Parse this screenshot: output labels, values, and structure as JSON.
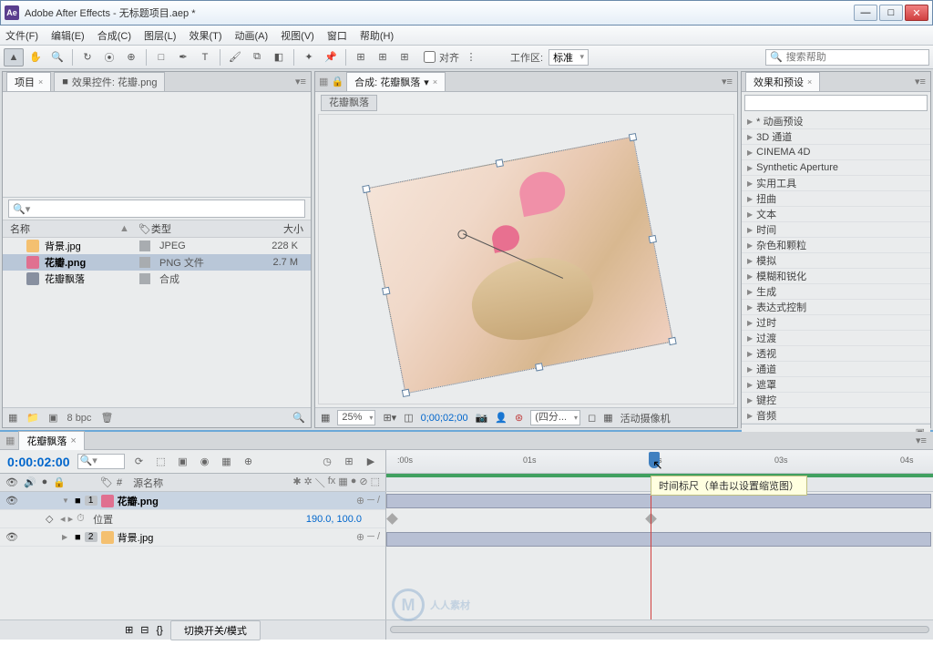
{
  "app": {
    "icon": "Ae",
    "title": "Adobe After Effects - 无标题项目.aep *"
  },
  "menu": [
    "文件(F)",
    "编辑(E)",
    "合成(C)",
    "图层(L)",
    "效果(T)",
    "动画(A)",
    "视图(V)",
    "窗口",
    "帮助(H)"
  ],
  "toolbar": {
    "align_label": "对齐",
    "workspace_label": "工作区:",
    "workspace_value": "标准",
    "search_placeholder": "搜索帮助"
  },
  "project": {
    "tab1": "项目",
    "tab2": "效果控件: 花瓣.png",
    "cols": {
      "name": "名称",
      "type": "类型",
      "size": "大小"
    },
    "items": [
      {
        "name": "背景.jpg",
        "type": "JPEG",
        "size": "228 K",
        "cls": "jpg"
      },
      {
        "name": "花瓣.png",
        "type": "PNG 文件",
        "size": "2.7 M",
        "cls": "png",
        "sel": true
      },
      {
        "name": "花瓣飘落",
        "type": "合成",
        "size": "",
        "cls": "comp"
      }
    ],
    "bpc": "8 bpc"
  },
  "comp": {
    "tab": "合成: 花瓣飘落",
    "name": "花瓣飘落",
    "zoom": "25%",
    "timecode": "0;00;02;00",
    "res": "(四分...",
    "camera": "活动摄像机"
  },
  "fx": {
    "tab": "效果和预设",
    "items": [
      "* 动画预设",
      "3D 通道",
      "CINEMA 4D",
      "Synthetic Aperture",
      "实用工具",
      "扭曲",
      "文本",
      "时间",
      "杂色和颗粒",
      "模拟",
      "模糊和锐化",
      "生成",
      "表达式控制",
      "过时",
      "过渡",
      "透视",
      "通道",
      "遮罩",
      "键控",
      "音频"
    ]
  },
  "timeline": {
    "tab": "花瓣飘落",
    "time": "0:00:02:00",
    "col_source": "源名称",
    "tooltip": "时间标尺（单击以设置缩览图）",
    "ticks": [
      {
        "label": ":00s",
        "pos": 2
      },
      {
        "label": "01s",
        "pos": 25
      },
      {
        "label": "02s",
        "pos": 48
      },
      {
        "label": "03s",
        "pos": 71
      },
      {
        "label": "04s",
        "pos": 94
      }
    ],
    "layers": [
      {
        "num": "1",
        "name": "花瓣.png",
        "cls": "png",
        "sel": true
      },
      {
        "prop": true,
        "name": "位置",
        "value": "190.0, 100.0"
      },
      {
        "num": "2",
        "name": "背景.jpg",
        "cls": "jpg"
      }
    ],
    "switch_btn": "切换开关/模式"
  },
  "watermark": "人人素材"
}
